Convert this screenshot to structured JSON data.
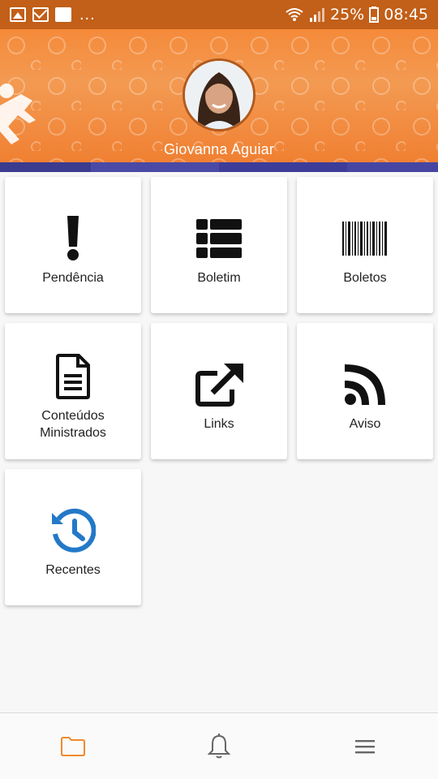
{
  "status_bar": {
    "notification_icons": [
      "image-icon",
      "mail-icon",
      "flipboard-icon"
    ],
    "more": "...",
    "battery": "25%",
    "time": "08:45"
  },
  "header": {
    "user_name": "Giovanna Aguiar"
  },
  "tiles": [
    {
      "label": "Pendência",
      "icon": "exclamation-icon"
    },
    {
      "label": "Boletim",
      "icon": "table-list-icon"
    },
    {
      "label": "Boletos",
      "icon": "barcode-icon"
    },
    {
      "label_line1": "Conteúdos",
      "label_line2": "Ministrados",
      "icon": "document-icon"
    },
    {
      "label": "Links",
      "icon": "external-link-icon"
    },
    {
      "label": "Aviso",
      "icon": "rss-icon"
    },
    {
      "label": "Recentes",
      "icon": "history-icon"
    }
  ],
  "bottom_nav": {
    "items": [
      "folder-icon",
      "bell-icon",
      "menu-icon"
    ],
    "active": "folder-icon"
  },
  "colors": {
    "status_bar": "#c25f18",
    "header": "#f58a3a",
    "accent_bar": "#3f3f9e",
    "active_nav": "#f08a2e",
    "history_icon": "#2379c8"
  }
}
